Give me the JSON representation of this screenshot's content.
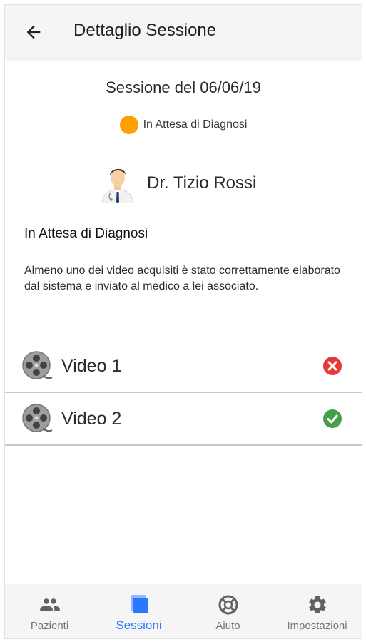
{
  "appbar": {
    "title": "Dettaglio Sessione",
    "back_icon": "arrow-left-icon"
  },
  "session": {
    "date_label": "Sessione del 06/06/19",
    "status": {
      "label": "In Attesa di Diagnosi",
      "color": "#ffa000"
    },
    "doctor": {
      "name": "Dr. Tizio Rossi",
      "avatar_icon": "doctor-avatar-icon"
    },
    "state_title": "In Attesa di Diagnosi",
    "state_description": "Almeno uno dei video acquisiti è stato correttamente elaborato dal sistema e inviato al medico a lei associato."
  },
  "videos": [
    {
      "label": "Video 1",
      "status": "error",
      "status_icon": "error-circle-icon",
      "status_color": "#e53935"
    },
    {
      "label": "Video 2",
      "status": "success",
      "status_icon": "check-circle-icon",
      "status_color": "#43a047"
    }
  ],
  "bottom_nav": {
    "active": "Sessioni",
    "active_color": "#2979ff",
    "items": [
      {
        "label": "Pazienti",
        "icon": "people-icon"
      },
      {
        "label": "Sessioni",
        "icon": "sessions-icon"
      },
      {
        "label": "Aiuto",
        "icon": "help-lifebuoy-icon"
      },
      {
        "label": "Impostazioni",
        "icon": "gear-icon"
      }
    ]
  }
}
